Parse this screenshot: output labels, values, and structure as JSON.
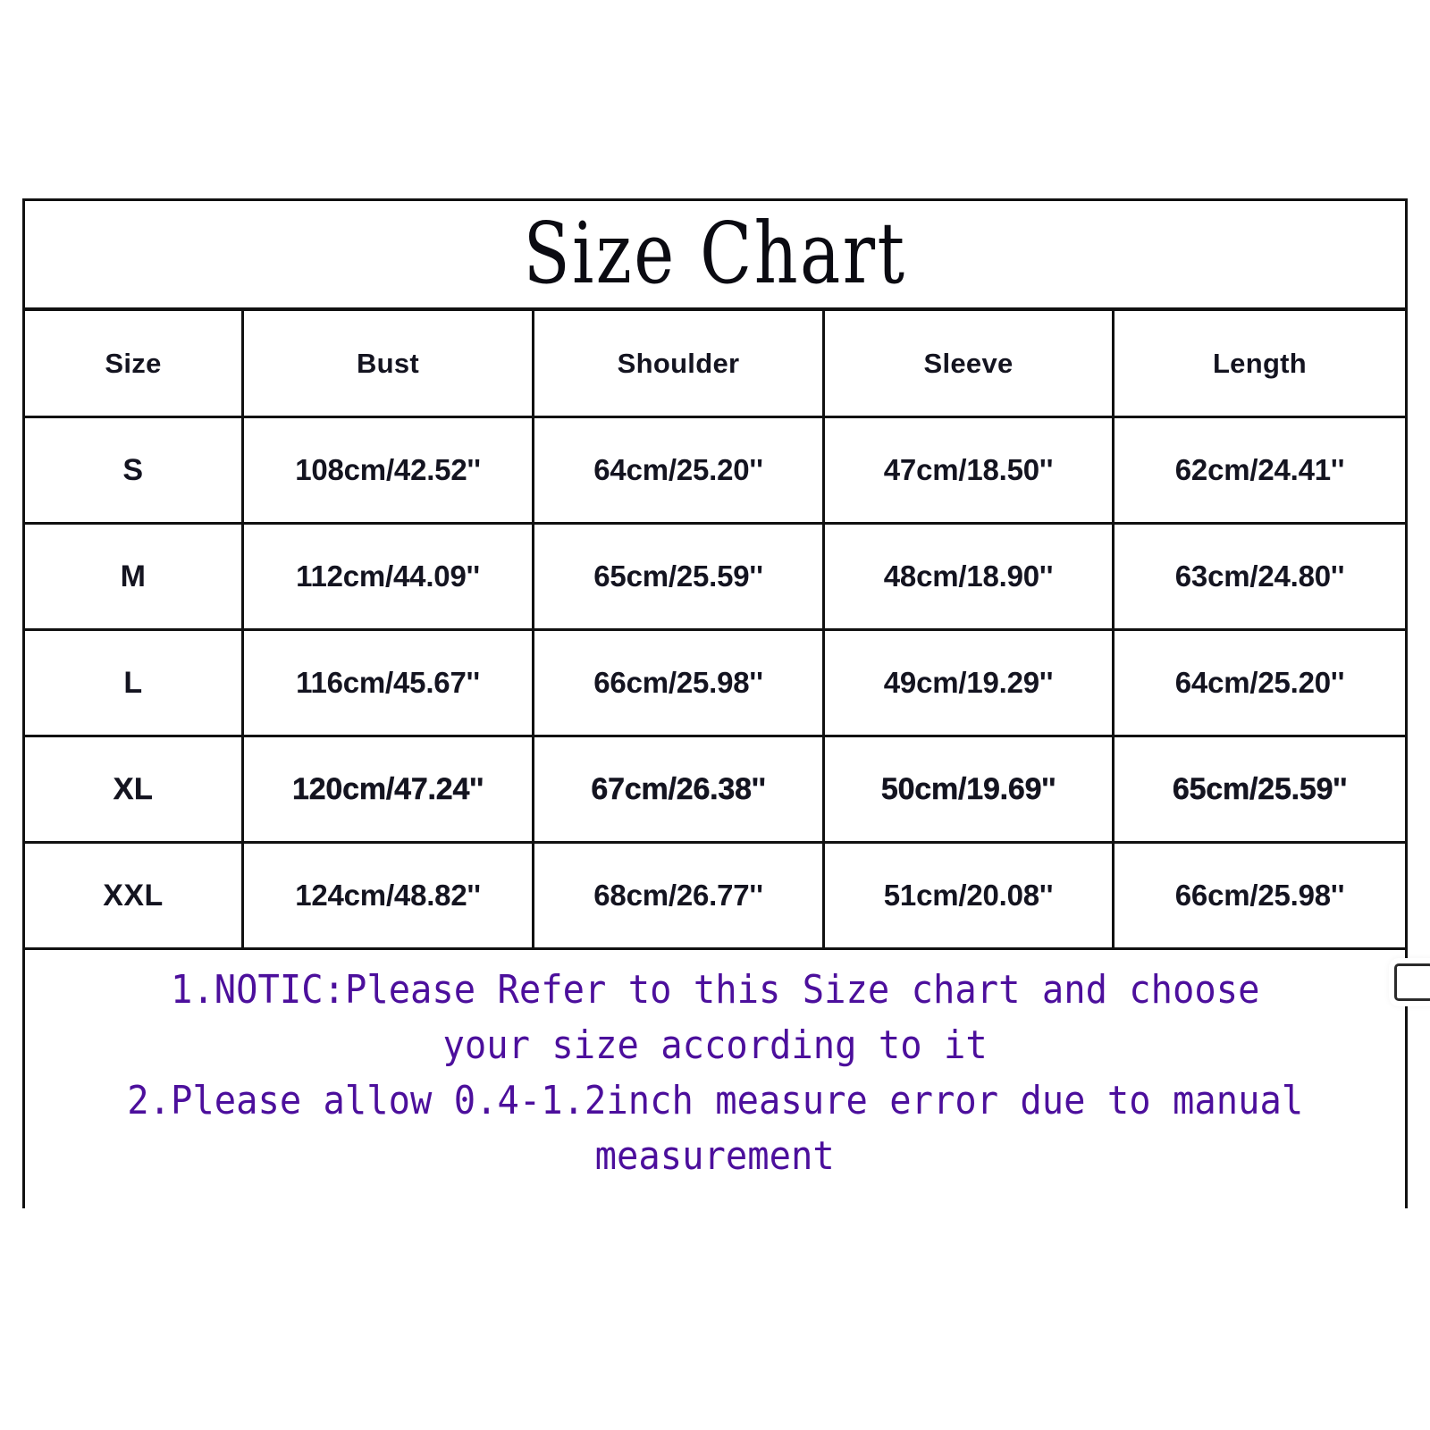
{
  "chart_data": {
    "type": "table",
    "title": "Size Chart",
    "columns": [
      "Size",
      "Bust",
      "Shoulder",
      "Sleeve",
      "Length"
    ],
    "rows": [
      {
        "size": "S",
        "bust": "108cm/42.52''",
        "shoulder": "64cm/25.20''",
        "sleeve": "47cm/18.50''",
        "length": "62cm/24.41''"
      },
      {
        "size": "M",
        "bust": "112cm/44.09''",
        "shoulder": "65cm/25.59''",
        "sleeve": "48cm/18.90''",
        "length": "63cm/24.80''"
      },
      {
        "size": "L",
        "bust": "116cm/45.67''",
        "shoulder": "66cm/25.98''",
        "sleeve": "49cm/19.29''",
        "length": "64cm/25.20''"
      },
      {
        "size": "XL",
        "bust": "120cm/47.24''",
        "shoulder": "67cm/26.38''",
        "sleeve": "50cm/19.69''",
        "length": "65cm/25.59''"
      },
      {
        "size": "XXL",
        "bust": "124cm/48.82''",
        "shoulder": "68cm/26.77''",
        "sleeve": "51cm/20.08''",
        "length": "66cm/25.98''"
      }
    ],
    "units": "cm / inches",
    "notes": [
      "1.NOTIC:Please Refer to this Size chart and choose",
      "your size according to it",
      "2.Please allow 0.4-1.2inch measure error due to manual",
      "measurement"
    ]
  },
  "table": {
    "title": "Size Chart",
    "headers": {
      "size": "Size",
      "bust": "Bust",
      "shoulder": "Shoulder",
      "sleeve": "Sleeve",
      "length": "Length"
    },
    "rows": [
      {
        "size": "S",
        "bust": "108cm/42.52''",
        "shoulder": "64cm/25.20''",
        "sleeve": "47cm/18.50''",
        "length": "62cm/24.41''"
      },
      {
        "size": "M",
        "bust": "112cm/44.09''",
        "shoulder": "65cm/25.59''",
        "sleeve": "48cm/18.90''",
        "length": "63cm/24.80''"
      },
      {
        "size": "L",
        "bust": "116cm/45.67''",
        "shoulder": "66cm/25.98''",
        "sleeve": "49cm/19.29''",
        "length": "64cm/25.20''"
      },
      {
        "size": "XL",
        "bust": "120cm/47.24''",
        "shoulder": "67cm/26.38''",
        "sleeve": "50cm/19.69''",
        "length": "65cm/25.59''"
      },
      {
        "size": "XXL",
        "bust": "124cm/48.82''",
        "shoulder": "68cm/26.77''",
        "sleeve": "51cm/20.08''",
        "length": "66cm/25.98''"
      }
    ]
  },
  "notice": {
    "line1": "1.NOTIC:Please Refer to this Size chart and choose",
    "line2": "your size according to it",
    "line3": "2.Please allow 0.4-1.2inch measure error due to manual",
    "line4": "measurement"
  },
  "colors": {
    "notice_text": "#4c0f9c",
    "table_border": "#111111",
    "body_text": "#141420",
    "background": "#ffffff"
  }
}
